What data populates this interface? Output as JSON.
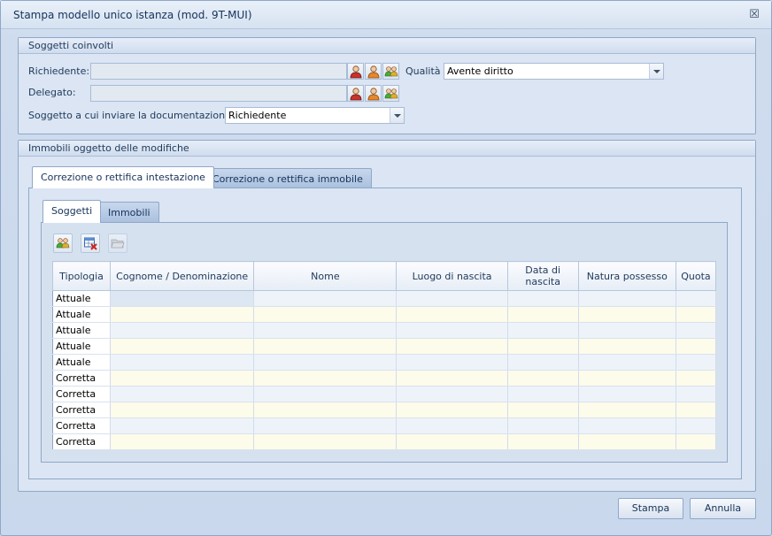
{
  "window": {
    "title": "Stampa modello unico istanza (mod. 9T-MUI)",
    "close_glyph": "☒"
  },
  "soggetti": {
    "header": "Soggetti coinvolti",
    "richiedente_label": "Richiedente:",
    "richiedente_value": "",
    "delegato_label": "Delegato:",
    "delegato_value": "",
    "qualita_label": "Qualità",
    "qualita_value": "Avente diritto",
    "invio_label": "Soggetto a cui inviare la documentazione:",
    "invio_value": "Richiedente",
    "person_icons": [
      "person-red-icon",
      "person-orange-icon",
      "people-group-icon"
    ]
  },
  "immobili": {
    "header": "Immobili oggetto delle modifiche",
    "tabs": [
      {
        "label": "Correzione o rettifica intestazione",
        "active": true
      },
      {
        "label": "Correzione o rettifica immobile",
        "active": false
      }
    ],
    "subtabs": [
      {
        "label": "Soggetti",
        "active": true
      },
      {
        "label": "Immobili",
        "active": false
      }
    ],
    "toolbar": [
      "add-people-icon",
      "delete-table-icon",
      "open-folder-icon"
    ],
    "grid": {
      "columns": [
        "Tipologia",
        "Cognome / Denominazione",
        "Nome",
        "Luogo di nascita",
        "Data di nascita",
        "Natura possesso",
        "Quota"
      ],
      "rows": [
        [
          "Attuale",
          "",
          "",
          "",
          "",
          "",
          ""
        ],
        [
          "Attuale",
          "",
          "",
          "",
          "",
          "",
          ""
        ],
        [
          "Attuale",
          "",
          "",
          "",
          "",
          "",
          ""
        ],
        [
          "Attuale",
          "",
          "",
          "",
          "",
          "",
          ""
        ],
        [
          "Attuale",
          "",
          "",
          "",
          "",
          "",
          ""
        ],
        [
          "Corretta",
          "",
          "",
          "",
          "",
          "",
          ""
        ],
        [
          "Corretta",
          "",
          "",
          "",
          "",
          "",
          ""
        ],
        [
          "Corretta",
          "",
          "",
          "",
          "",
          "",
          ""
        ],
        [
          "Corretta",
          "",
          "",
          "",
          "",
          "",
          ""
        ],
        [
          "Corretta",
          "",
          "",
          "",
          "",
          "",
          ""
        ]
      ]
    }
  },
  "footer": {
    "stampa_label": "Stampa",
    "annulla_label": "Annulla"
  }
}
